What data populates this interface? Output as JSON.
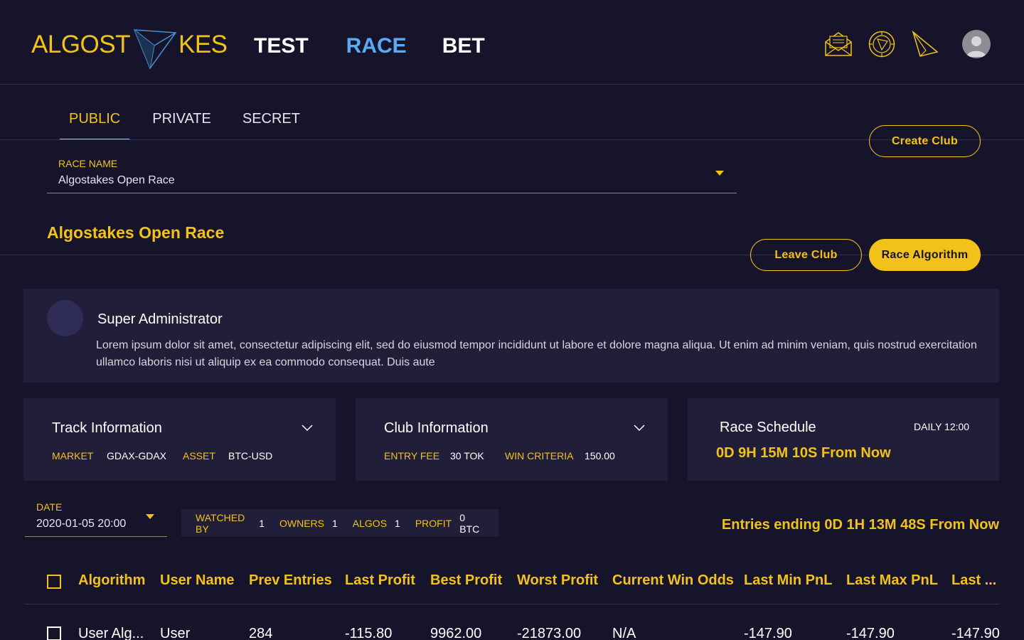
{
  "app": {
    "logo_left": "ALGOST",
    "logo_right": "KES"
  },
  "nav": {
    "items": [
      {
        "label": "TEST",
        "active": false
      },
      {
        "label": "RACE",
        "active": true
      },
      {
        "label": "BET",
        "active": false
      }
    ]
  },
  "header_icons": [
    "mail-icon",
    "coin-icon",
    "send-icon",
    "user-avatar"
  ],
  "tabs": [
    {
      "label": "PUBLIC",
      "active": true
    },
    {
      "label": "PRIVATE",
      "active": false
    },
    {
      "label": "SECRET",
      "active": false
    }
  ],
  "buttons": {
    "create_club": "Create Club",
    "leave_club": "Leave Club",
    "race_algorithm": "Race Algorithm"
  },
  "race_select": {
    "label": "RACE NAME",
    "value": "Algostakes Open Race"
  },
  "race_title": "Algostakes Open Race",
  "admin": {
    "name": "Super Administrator",
    "description": "Lorem ipsum dolor sit amet, consectetur adipiscing elit, sed do eiusmod tempor incididunt ut labore et dolore magna aliqua. Ut enim ad minim veniam, quis nostrud exercitation ullamco laboris nisi ut aliquip ex ea commodo consequat. Duis aute"
  },
  "track_info": {
    "title": "Track Information",
    "market_label": "MARKET",
    "market_value": "GDAX-GDAX",
    "asset_label": "ASSET",
    "asset_value": "BTC-USD"
  },
  "club_info": {
    "title": "Club Information",
    "entry_fee_label": "ENTRY FEE",
    "entry_fee_value": "30 TOK",
    "win_criteria_label": "WIN CRITERIA",
    "win_criteria_value": "150.00"
  },
  "race_schedule": {
    "title": "Race Schedule",
    "frequency": "DAILY 12:00",
    "countdown": "0D 9H 15M 10S From Now"
  },
  "date_select": {
    "label": "DATE",
    "value": "2020-01-05 20:00"
  },
  "stats": {
    "watched_by_label": "WATCHED BY",
    "watched_by_value": "1",
    "owners_label": "OWNERS",
    "owners_value": "1",
    "algos_label": "ALGOS",
    "algos_value": "1",
    "profit_label": "PROFIT",
    "profit_value": "0 BTC"
  },
  "entries_ending": "Entries ending 0D 1H 13M 48S From Now",
  "table": {
    "columns": [
      "Algorithm",
      "User Name",
      "Prev Entries",
      "Last Profit",
      "Best Profit",
      "Worst Profit",
      "Current Win Odds",
      "Last Min PnL",
      "Last Max PnL",
      "Last ..."
    ],
    "rows": [
      [
        "User Alg...",
        "User",
        "284",
        "-115.80",
        "9962.00",
        "-21873.00",
        "N/A",
        "-147.90",
        "-147.90",
        "-147.90"
      ]
    ]
  },
  "colors": {
    "accent": "#f2c21b",
    "active_nav": "#5aaaf5",
    "background": "#16142a",
    "card": "#201e38"
  }
}
